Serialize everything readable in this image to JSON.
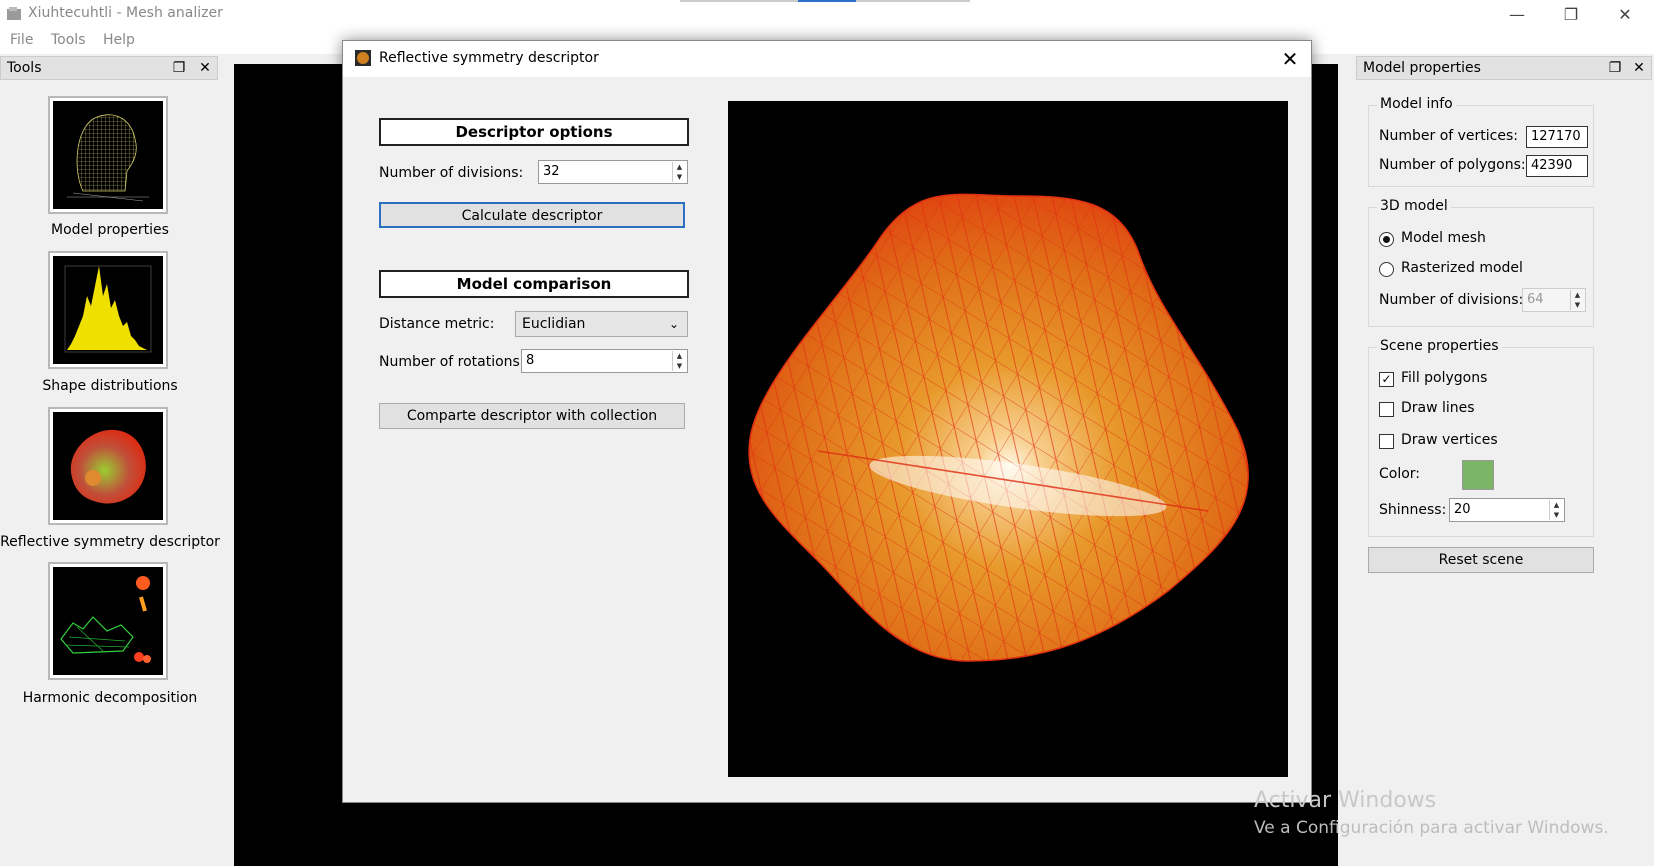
{
  "app": {
    "title": "Xiuhtecuhtli - Mesh analizer"
  },
  "menu": [
    "File",
    "Tools",
    "Help"
  ],
  "window_controls": {
    "minimize": "—",
    "restore": "❐",
    "close": "✕"
  },
  "tools_dock": {
    "title": "Tools",
    "float_icon": "❐",
    "close_icon": "✕",
    "items": [
      {
        "label": "Model properties",
        "icon": "mesh-head-thumbnail"
      },
      {
        "label": "Shape distributions",
        "icon": "histogram-thumbnail"
      },
      {
        "label": "Reflective symmetry descriptor",
        "icon": "symmetry-blob-thumbnail"
      },
      {
        "label": "Harmonic decomposition",
        "icon": "harmonic-thumbnail"
      }
    ]
  },
  "dialog": {
    "title": "Reflective symmetry descriptor",
    "close_icon": "✕",
    "descriptor_options": {
      "header": "Descriptor options",
      "divisions_label": "Number of divisions:",
      "divisions_value": "32",
      "calculate_button": "Calculate descriptor"
    },
    "model_comparison": {
      "header": "Model comparison",
      "metric_label": "Distance metric:",
      "metric_value": "Euclidian",
      "rotations_label": "Number of rotations:",
      "rotations_value": "8",
      "compare_button": "Comparte descriptor with collection"
    }
  },
  "model_properties": {
    "title": "Model properties",
    "float_icon": "❐",
    "close_icon": "✕",
    "model_info": {
      "title": "Model info",
      "vertices_label": "Number of vertices:",
      "vertices_value": "127170",
      "polygons_label": "Number of polygons:",
      "polygons_value": "42390"
    },
    "model_3d": {
      "title": "3D model",
      "mesh_label": "Model mesh",
      "rasterized_label": "Rasterized model",
      "divisions_label": "Number of divisions:",
      "divisions_value": "64",
      "selected": "Model mesh"
    },
    "scene": {
      "title": "Scene properties",
      "fill_polygons": "Fill polygons",
      "fill_checked": true,
      "draw_lines": "Draw lines",
      "draw_vertices": "Draw vertices",
      "color_label": "Color:",
      "color_value": "#7db567",
      "check_mark": "✓",
      "shininess_label": "Shinness:",
      "shininess_value": "20",
      "reset_button": "Reset scene"
    }
  },
  "watermark": {
    "line1": "Activar Windows",
    "line2": "Ve a Configuración para activar Windows."
  }
}
